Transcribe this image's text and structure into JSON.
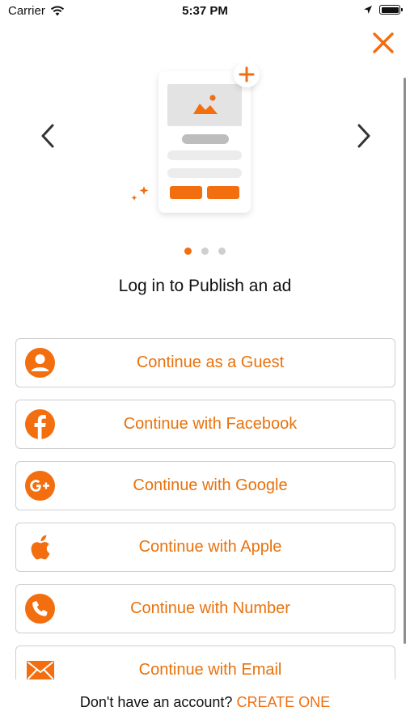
{
  "status_bar": {
    "carrier": "Carrier",
    "time": "5:37 PM",
    "icons": [
      "wifi-icon",
      "location-arrow-icon",
      "battery-icon"
    ]
  },
  "header": {
    "close_icon": "close-icon"
  },
  "carousel": {
    "prev_icon": "chevron-left-icon",
    "next_icon": "chevron-right-icon",
    "illustration": "publish-ad-illustration",
    "page_count": 3,
    "active_page": 1
  },
  "headline": "Log in to Publish an ad",
  "login_options": [
    {
      "label": "Continue as a Guest",
      "icon": "user-icon"
    },
    {
      "label": "Continue with Facebook",
      "icon": "facebook-icon"
    },
    {
      "label": "Continue with Google",
      "icon": "google-plus-icon"
    },
    {
      "label": "Continue with Apple",
      "icon": "apple-icon"
    },
    {
      "label": "Continue with Number",
      "icon": "phone-icon"
    },
    {
      "label": "Continue with Email",
      "icon": "mail-icon"
    }
  ],
  "footer": {
    "prompt": "Don't have an account?",
    "cta": "CREATE ONE"
  },
  "colors": {
    "accent": "#F26E0F",
    "border": "#CFCFCF",
    "text": "#111111"
  }
}
